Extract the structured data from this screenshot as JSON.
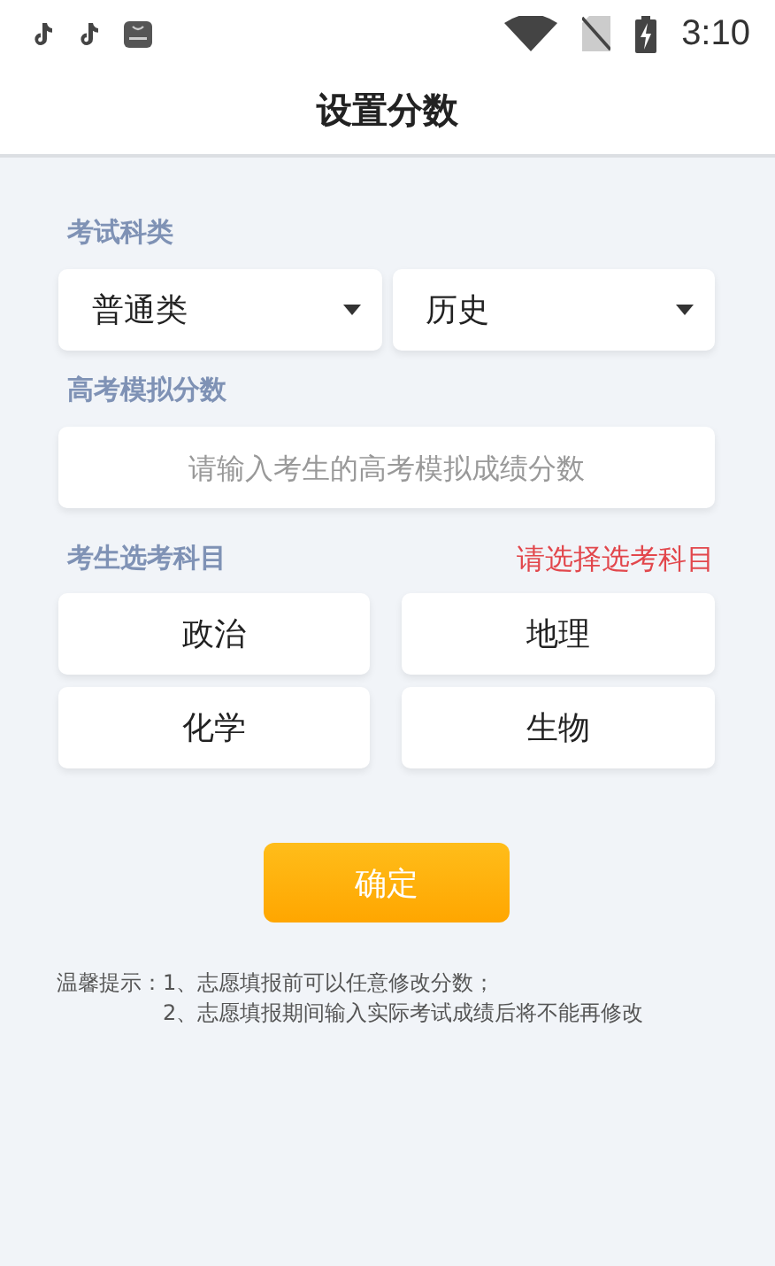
{
  "status_bar": {
    "time": "3:10"
  },
  "header": {
    "title": "设置分数"
  },
  "exam_type": {
    "label": "考试科类",
    "selects": [
      {
        "value": "普通类"
      },
      {
        "value": "历史"
      }
    ]
  },
  "mock_score": {
    "label": "高考模拟分数",
    "placeholder": "请输入考生的高考模拟成绩分数"
  },
  "elective": {
    "label": "考生选考科目",
    "hint": "请选择选考科目",
    "subjects": [
      {
        "label": "政治",
        "selected": false
      },
      {
        "label": "地理",
        "selected": false
      },
      {
        "label": "化学",
        "selected": false
      },
      {
        "label": "生物",
        "selected": false
      }
    ]
  },
  "confirm_button": "确定",
  "tips": {
    "label": "温馨提示：",
    "lines": [
      "1、志愿填报前可以任意修改分数；",
      "2、志愿填报期间输入实际考试成绩后将不能再修改"
    ]
  }
}
